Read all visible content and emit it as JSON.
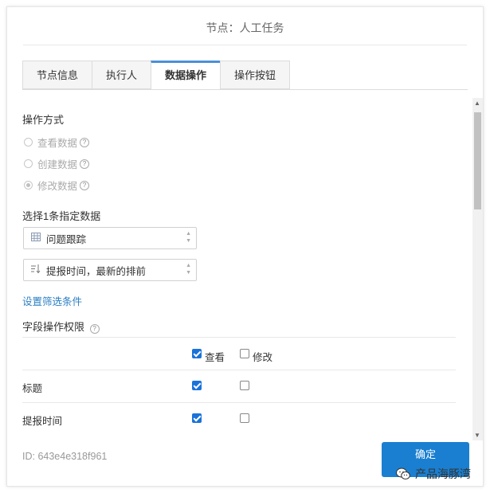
{
  "dialog": {
    "title": "节点：人工任务"
  },
  "tabs": [
    {
      "label": "节点信息"
    },
    {
      "label": "执行人"
    },
    {
      "label": "数据操作"
    },
    {
      "label": "操作按钮"
    }
  ],
  "active_tab": "数据操作",
  "operation": {
    "label": "操作方式",
    "options": [
      {
        "label": "查看数据",
        "selected": false
      },
      {
        "label": "创建数据",
        "selected": false
      },
      {
        "label": "修改数据",
        "selected": true
      }
    ]
  },
  "select_data": {
    "label": "选择1条指定数据",
    "table_select": "问题跟踪",
    "sort_select": "提报时间，最新的排前",
    "filter_link": "设置筛选条件"
  },
  "permissions": {
    "label": "字段操作权限",
    "header": {
      "view": "查看",
      "edit": "修改",
      "view_checked": true,
      "edit_checked": false
    },
    "rows": [
      {
        "field": "标题",
        "view": true,
        "edit": false
      },
      {
        "field": "提报时间",
        "view": true,
        "edit": false
      }
    ]
  },
  "footer": {
    "id_text": "ID: 643e4e318f961",
    "confirm_label": "确定"
  },
  "watermark": {
    "text": "产品海豚湾"
  },
  "colors": {
    "accent": "#1a7fd0",
    "tab_active_border": "#4a90d9",
    "link": "#2b7fc4"
  }
}
